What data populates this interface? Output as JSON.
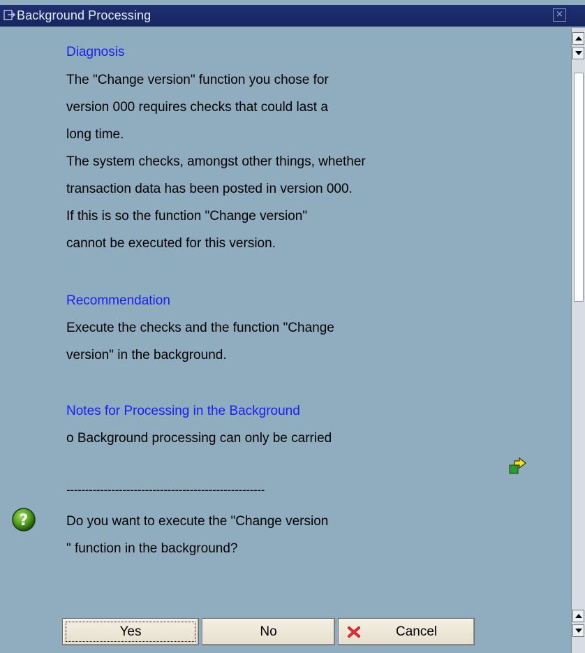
{
  "window": {
    "title": "Background Processing"
  },
  "message": {
    "diagnosis_heading": "Diagnosis",
    "diagnosis_lines": [
      "The \"Change version\" function you chose for",
      "version 000 requires checks that could last a",
      "long time.",
      "The system checks, amongst other things, whether",
      "transaction data has been posted in version 000.",
      "If this is so the function \"Change version\"",
      "cannot be executed for this version."
    ],
    "recommendation_heading": "Recommendation",
    "recommendation_lines": [
      "Execute the checks and the function \"Change",
      "version\" in the background."
    ],
    "notes_heading": "Notes for Processing in the Background",
    "notes_lines": [
      "o Background processing can only be carried"
    ],
    "separator": "-----------------------------------------------------",
    "question_lines": [
      "Do you want to execute the \"Change version",
      "\" function in the background?"
    ]
  },
  "buttons": {
    "yes": "Yes",
    "no": "No",
    "cancel": "Cancel"
  },
  "icons": {
    "title": "dialog-icon",
    "question": "question-icon",
    "navigate": "forward-arrow-icon",
    "cancel": "red-x-icon",
    "close": "close-icon"
  },
  "colors": {
    "background": "#90acbf",
    "titlebar": "#1e2f72",
    "heading": "#1d1df3"
  }
}
